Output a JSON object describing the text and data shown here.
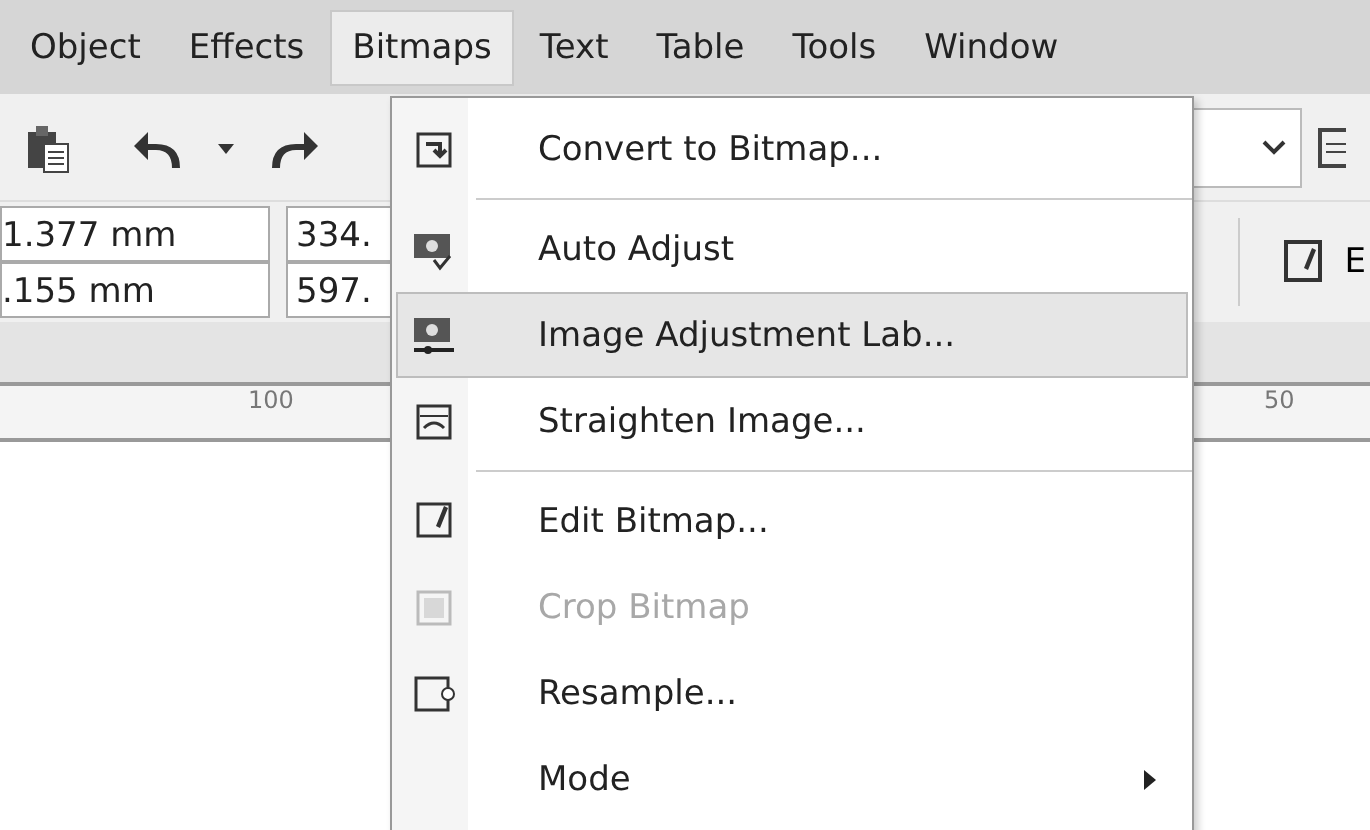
{
  "menu_bar": [
    {
      "label": "Object",
      "selected": false
    },
    {
      "label": "Effects",
      "selected": false
    },
    {
      "label": "Bitmaps",
      "selected": true
    },
    {
      "label": "Text",
      "selected": false
    },
    {
      "label": "Table",
      "selected": false
    },
    {
      "label": "Tools",
      "selected": false
    },
    {
      "label": "Window",
      "selected": false
    }
  ],
  "property_bar": {
    "fields": [
      {
        "value": "1.377 mm"
      },
      {
        "value": ".155 mm"
      },
      {
        "value": "334."
      },
      {
        "value": "597."
      }
    ],
    "right_button": {
      "label": "E"
    }
  },
  "ruler": {
    "labels": [
      "100",
      "50"
    ]
  },
  "bitmaps_menu": [
    {
      "kind": "item",
      "label": "Convert to Bitmap...",
      "disabled": false,
      "selected": false
    },
    {
      "kind": "separator"
    },
    {
      "kind": "item",
      "label": "Auto Adjust",
      "disabled": false,
      "selected": false
    },
    {
      "kind": "item",
      "label": "Image Adjustment Lab...",
      "disabled": false,
      "selected": true
    },
    {
      "kind": "item",
      "label": "Straighten Image...",
      "disabled": false,
      "selected": false
    },
    {
      "kind": "separator"
    },
    {
      "kind": "item",
      "label": "Edit Bitmap...",
      "disabled": false,
      "selected": false
    },
    {
      "kind": "item",
      "label": "Crop Bitmap",
      "disabled": true,
      "selected": false
    },
    {
      "kind": "item",
      "label": "Resample...",
      "disabled": false,
      "selected": false
    },
    {
      "kind": "submenu",
      "label": "Mode",
      "disabled": false,
      "selected": false
    }
  ]
}
